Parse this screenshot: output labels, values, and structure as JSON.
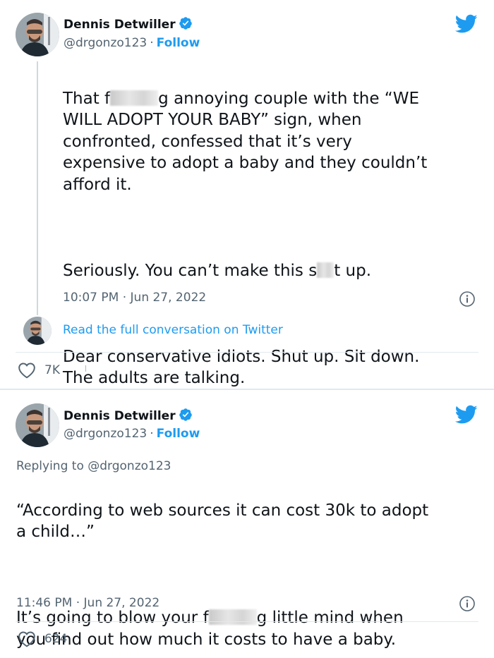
{
  "tweet1": {
    "author_name": "Dennis Detwiller",
    "handle": "@drgonzo123",
    "separator": "·",
    "follow_label": "Follow",
    "text_line1_a": "That f",
    "text_line1_b": "g annoying couple with the “WE",
    "text_rest": "WILL ADOPT YOUR BABY” sign, when\nconfronted, confessed that it’s very\nexpensive to adopt a baby and they couldn’t\nafford it.",
    "paragraph2_a": "Seriously. You can’t make this s",
    "paragraph2_b": "t up.",
    "paragraph3": "Dear conservative idiots. Shut up. Sit down.\nThe adults are talking.",
    "timestamp": "10:07 PM · Jun 27, 2022",
    "read_full": "Read the full conversation on Twitter",
    "likes": "7K"
  },
  "tweet2": {
    "author_name": "Dennis Detwiller",
    "handle": "@drgonzo123",
    "separator": "·",
    "follow_label": "Follow",
    "replying_to": "Replying to @drgonzo123",
    "quote": "“According to web sources it can cost 30k to adopt\na child…”",
    "line_a": "It’s going to blow your f",
    "line_b": "g little mind when",
    "line_rest": "you find out how much it costs to have a baby.",
    "timestamp": "11:46 PM · Jun 27, 2022",
    "likes": "624"
  },
  "colors": {
    "twitter_blue": "#1d9bf0",
    "text": "#0f1419",
    "muted": "#536471",
    "border": "#e1e8ed"
  },
  "icons": [
    "verified-badge-icon",
    "twitter-bird-icon",
    "info-icon",
    "heart-icon"
  ]
}
